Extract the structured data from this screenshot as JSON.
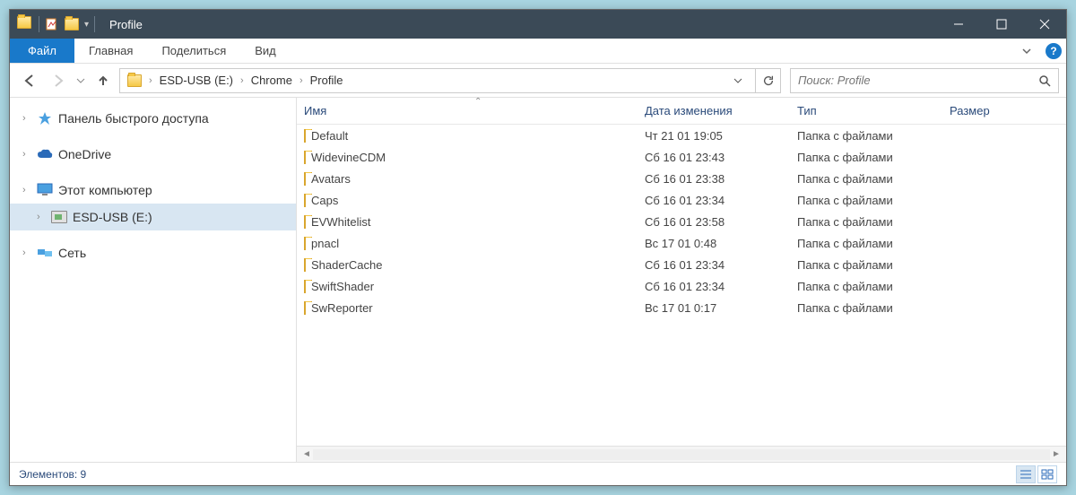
{
  "title": "Profile",
  "ribbon": {
    "file": "Файл",
    "tabs": [
      "Главная",
      "Поделиться",
      "Вид"
    ]
  },
  "breadcrumb": [
    "ESD-USB (E:)",
    "Chrome",
    "Profile"
  ],
  "search": {
    "placeholder": "Поиск: Profile"
  },
  "sidebar": {
    "quickaccess": "Панель быстрого доступа",
    "onedrive": "OneDrive",
    "thispc": "Этот компьютер",
    "esdusb": "ESD-USB (E:)",
    "network": "Сеть"
  },
  "columns": {
    "name": "Имя",
    "date": "Дата изменения",
    "type": "Тип",
    "size": "Размер"
  },
  "type_label": "Папка с файлами",
  "items": [
    {
      "name": "Default",
      "date": "Чт 21 01 19:05"
    },
    {
      "name": "WidevineCDM",
      "date": "Сб 16 01 23:43"
    },
    {
      "name": "Avatars",
      "date": "Сб 16 01 23:38"
    },
    {
      "name": "Caps",
      "date": "Сб 16 01 23:34"
    },
    {
      "name": "EVWhitelist",
      "date": "Сб 16 01 23:58"
    },
    {
      "name": "pnacl",
      "date": "Вс 17 01 0:48"
    },
    {
      "name": "ShaderCache",
      "date": "Сб 16 01 23:34"
    },
    {
      "name": "SwiftShader",
      "date": "Сб 16 01 23:34"
    },
    {
      "name": "SwReporter",
      "date": "Вс 17 01 0:17"
    }
  ],
  "status": "Элементов: 9"
}
